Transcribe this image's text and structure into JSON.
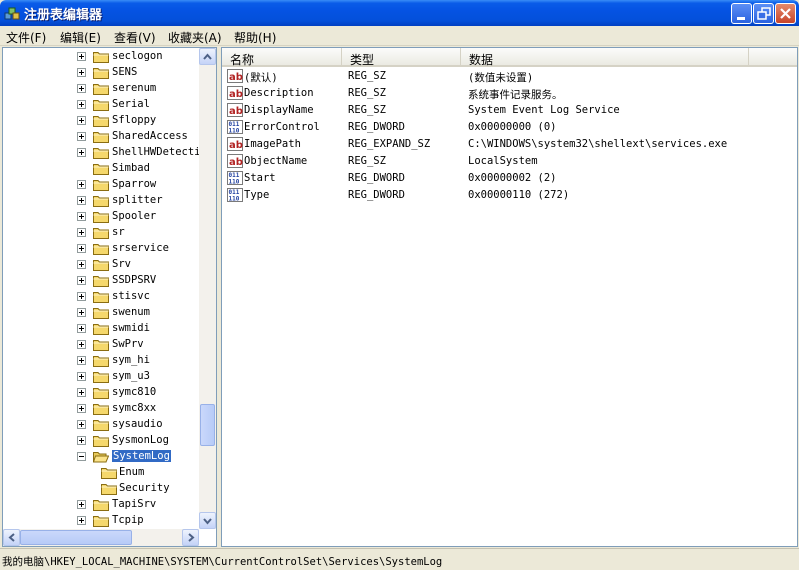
{
  "window": {
    "title": "注册表编辑器"
  },
  "menu": [
    {
      "label": "文件(F)"
    },
    {
      "label": "编辑(E)"
    },
    {
      "label": "查看(V)"
    },
    {
      "label": "收藏夹(A)"
    },
    {
      "label": "帮助(H)"
    }
  ],
  "tree": [
    {
      "label": "seclogon",
      "expandable": true,
      "expanded": false,
      "selected": false
    },
    {
      "label": "SENS",
      "expandable": true,
      "expanded": false,
      "selected": false
    },
    {
      "label": "serenum",
      "expandable": true,
      "expanded": false,
      "selected": false
    },
    {
      "label": "Serial",
      "expandable": true,
      "expanded": false,
      "selected": false
    },
    {
      "label": "Sfloppy",
      "expandable": true,
      "expanded": false,
      "selected": false
    },
    {
      "label": "SharedAccess",
      "expandable": true,
      "expanded": false,
      "selected": false
    },
    {
      "label": "ShellHWDetecti",
      "expandable": true,
      "expanded": false,
      "selected": false
    },
    {
      "label": "Simbad",
      "expandable": false,
      "expanded": false,
      "selected": false
    },
    {
      "label": "Sparrow",
      "expandable": true,
      "expanded": false,
      "selected": false
    },
    {
      "label": "splitter",
      "expandable": true,
      "expanded": false,
      "selected": false
    },
    {
      "label": "Spooler",
      "expandable": true,
      "expanded": false,
      "selected": false
    },
    {
      "label": "sr",
      "expandable": true,
      "expanded": false,
      "selected": false
    },
    {
      "label": "srservice",
      "expandable": true,
      "expanded": false,
      "selected": false
    },
    {
      "label": "Srv",
      "expandable": true,
      "expanded": false,
      "selected": false
    },
    {
      "label": "SSDPSRV",
      "expandable": true,
      "expanded": false,
      "selected": false
    },
    {
      "label": "stisvc",
      "expandable": true,
      "expanded": false,
      "selected": false
    },
    {
      "label": "swenum",
      "expandable": true,
      "expanded": false,
      "selected": false
    },
    {
      "label": "swmidi",
      "expandable": true,
      "expanded": false,
      "selected": false
    },
    {
      "label": "SwPrv",
      "expandable": true,
      "expanded": false,
      "selected": false
    },
    {
      "label": "sym_hi",
      "expandable": true,
      "expanded": false,
      "selected": false
    },
    {
      "label": "sym_u3",
      "expandable": true,
      "expanded": false,
      "selected": false
    },
    {
      "label": "symc810",
      "expandable": true,
      "expanded": false,
      "selected": false
    },
    {
      "label": "symc8xx",
      "expandable": true,
      "expanded": false,
      "selected": false
    },
    {
      "label": "sysaudio",
      "expandable": true,
      "expanded": false,
      "selected": false
    },
    {
      "label": "SysmonLog",
      "expandable": true,
      "expanded": false,
      "selected": false
    },
    {
      "label": "SystemLog",
      "expandable": true,
      "expanded": true,
      "selected": true
    },
    {
      "label": "Enum",
      "expandable": false,
      "expanded": false,
      "selected": false,
      "child": true
    },
    {
      "label": "Security",
      "expandable": false,
      "expanded": false,
      "selected": false,
      "child": true
    },
    {
      "label": "TapiSrv",
      "expandable": true,
      "expanded": false,
      "selected": false
    },
    {
      "label": "Tcpip",
      "expandable": true,
      "expanded": false,
      "selected": false
    }
  ],
  "columns": {
    "name": "名称",
    "type": "类型",
    "data": "数据"
  },
  "values": [
    {
      "icon": "string-value-icon",
      "name": "(默认)",
      "type": "REG_SZ",
      "data": "(数值未设置)"
    },
    {
      "icon": "string-value-icon",
      "name": "Description",
      "type": "REG_SZ",
      "data": "系统事件记录服务。"
    },
    {
      "icon": "string-value-icon",
      "name": "DisplayName",
      "type": "REG_SZ",
      "data": "System Event Log Service"
    },
    {
      "icon": "binary-value-icon",
      "name": "ErrorControl",
      "type": "REG_DWORD",
      "data": "0x00000000 (0)"
    },
    {
      "icon": "string-value-icon",
      "name": "ImagePath",
      "type": "REG_EXPAND_SZ",
      "data": "C:\\WINDOWS\\system32\\shellext\\services.exe"
    },
    {
      "icon": "string-value-icon",
      "name": "ObjectName",
      "type": "REG_SZ",
      "data": "LocalSystem"
    },
    {
      "icon": "binary-value-icon",
      "name": "Start",
      "type": "REG_DWORD",
      "data": "0x00000002 (2)"
    },
    {
      "icon": "binary-value-icon",
      "name": "Type",
      "type": "REG_DWORD",
      "data": "0x00000110 (272)"
    }
  ],
  "status": {
    "path": "我的电脑\\HKEY_LOCAL_MACHINE\\SYSTEM\\CurrentControlSet\\Services\\SystemLog"
  },
  "colors": {
    "title_bar": "#0553e3",
    "selection": "#316ac5"
  }
}
